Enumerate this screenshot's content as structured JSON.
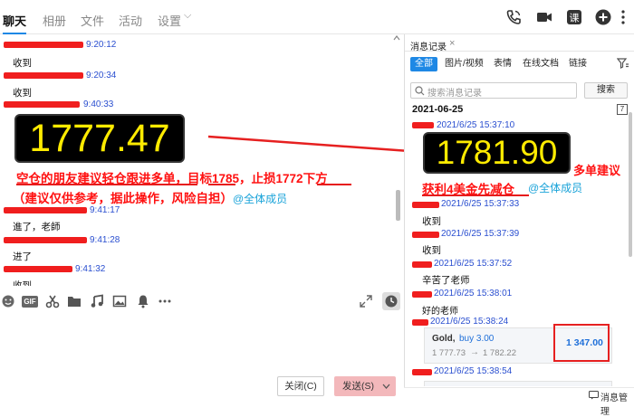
{
  "nav": {
    "tabs": [
      "聊天",
      "相册",
      "文件",
      "活动",
      "设置"
    ],
    "settings_chevron": "⌵"
  },
  "chat": {
    "messages": [
      {
        "time": "9:20:12",
        "text": "收到"
      },
      {
        "time": "9:20:34",
        "text": "收到"
      },
      {
        "time": "9:40:33",
        "text": ""
      },
      {
        "time": "9:41:17",
        "text": "進了，老師"
      },
      {
        "time": "9:41:28",
        "text": "进了"
      },
      {
        "time": "9:41:32",
        "text": "收到"
      }
    ],
    "price_main": "1777.47",
    "annotation_line1": "空仓的朋友建议轻仓跟进多单，目标1785，止损1772下方",
    "annotation_line2": "（建议仅供参考，据此操作，风险自担）",
    "mention": "@全体成员"
  },
  "toolbar": {
    "gif_label": "GIF"
  },
  "footer": {
    "close_label": "关闭(C)",
    "send_label": "发送(S)"
  },
  "history": {
    "title": "消息记录",
    "close_x": "×",
    "tabs": [
      "全部",
      "图片/视频",
      "表情",
      "在线文档",
      "链接"
    ],
    "search_placeholder": "搜索消息记录",
    "search_button": "搜索",
    "date": "2021-06-25",
    "calendar_icon_text": "7",
    "entries": [
      {
        "time": "2021/6/25 15:37:10",
        "text": ""
      },
      {
        "time": "2021/6/25 15:37:33",
        "text": "收到"
      },
      {
        "time": "2021/6/25 15:37:39",
        "text": "收到"
      },
      {
        "time": "2021/6/25 15:37:52",
        "text": "辛苦了老师"
      },
      {
        "time": "2021/6/25 15:38:01",
        "text": "好的老师"
      },
      {
        "time": "2021/6/25 15:38:24",
        "text": ""
      },
      {
        "time": "2021/6/25 15:38:54",
        "text": ""
      }
    ],
    "price_box": "1781.90",
    "red_note_1": "多单建议",
    "red_note_2": "获利4美金先减仓",
    "mention": "@全体成员",
    "card": {
      "symbol": "Gold,",
      "action": "buy 3.00",
      "from": "1 777.73",
      "arrow": "→",
      "to": "1 782.22",
      "profit": "1 347.00"
    },
    "manage_label": "消息管理"
  }
}
